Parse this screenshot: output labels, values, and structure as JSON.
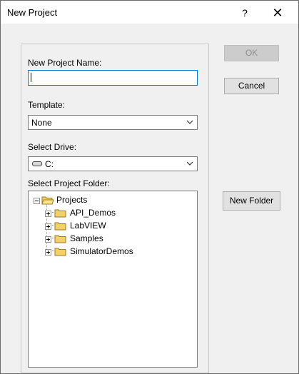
{
  "window": {
    "title": "New Project",
    "help_glyph": "?",
    "close_glyph": "✕"
  },
  "form": {
    "project_name_label": "New Project Name:",
    "project_name_value": "",
    "template_label": "Template:",
    "template_value": "None",
    "drive_label": "Select Drive:",
    "drive_value": "C:",
    "folder_label": "Select Project Folder:"
  },
  "tree": {
    "root": "Projects",
    "children": [
      "API_Demos",
      "LabVIEW",
      "Samples",
      "SimulatorDemos"
    ]
  },
  "buttons": {
    "ok": "OK",
    "cancel": "Cancel",
    "new_folder": "New Folder"
  },
  "icons": {
    "folder": "folder-icon",
    "open_folder": "open-folder-icon",
    "drive": "drive-icon",
    "dropdown": "chevron-down-icon"
  }
}
